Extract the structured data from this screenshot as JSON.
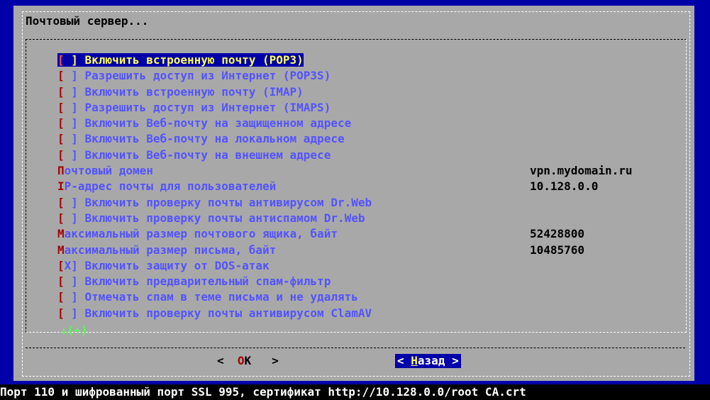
{
  "dialog_title": "Почтовый сервер...",
  "items": [
    {
      "prefix": "[",
      "text": " ] Включить встроенную почту (POP3)",
      "value": "",
      "selected": true
    },
    {
      "prefix": "[",
      "text": " ] Разрешить доступ из Интернет (POP3S)",
      "value": ""
    },
    {
      "prefix": "[",
      "text": " ] Включить встроенную почту (IMAP)",
      "value": ""
    },
    {
      "prefix": "[",
      "text": " ] Разрешить доступ из Интернет (IMAPS)",
      "value": ""
    },
    {
      "prefix": "[",
      "text": " ] Включить Веб-почту на защищенном адресе",
      "value": ""
    },
    {
      "prefix": "[",
      "text": " ] Включить Веб-почту на локальном адресе",
      "value": ""
    },
    {
      "prefix": "[",
      "text": " ] Включить Веб-почту на внешнем адресе",
      "value": ""
    },
    {
      "prefix": "П",
      "text": "очтовый домен",
      "value": "vpn.mydomain.ru"
    },
    {
      "prefix": "I",
      "text": "P-адрес почты для пользователей",
      "value": "10.128.0.0"
    },
    {
      "prefix": "[",
      "text": " ] Включить проверку почты антивирусом Dr.Web",
      "value": ""
    },
    {
      "prefix": "[",
      "text": " ] Включить проверку почты антиспамом Dr.Web",
      "value": ""
    },
    {
      "prefix": "М",
      "text": "аксимальный размер почтового ящика, байт",
      "value": "52428800"
    },
    {
      "prefix": "М",
      "text": "аксимальный размер письма, байт",
      "value": "10485760"
    },
    {
      "prefix": "[",
      "text": "X] Включить защиту от DOS-атак",
      "value": ""
    },
    {
      "prefix": "[",
      "text": " ] Включить предварительный спам-фильтр",
      "value": ""
    },
    {
      "prefix": "[",
      "text": " ] Отмечать спам в теме письма и не удалять",
      "value": ""
    },
    {
      "prefix": "[",
      "text": " ] Включить проверку почты антивирусом ClamAV",
      "value": ""
    }
  ],
  "more_indicator": "↓(+)",
  "buttons": {
    "ok_left": "<  ",
    "ok_hotkey": "O",
    "ok_rest": "K",
    "ok_right": "   >",
    "back_left": "< ",
    "back_hotkey": "Н",
    "back_rest": "азад >"
  },
  "status_bar": "Порт 110 и шифрованный порт SSL 995, сертификат http://10.128.0.0/root CA.crt"
}
